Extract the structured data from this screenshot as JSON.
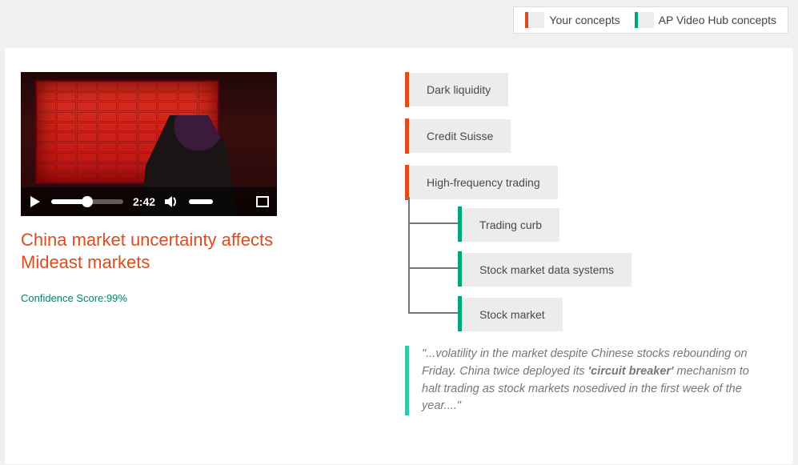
{
  "legend": {
    "yours": "Your concepts",
    "ap": "AP Video Hub concepts"
  },
  "video": {
    "time": "2:42"
  },
  "headline": "China market uncertainty affects Mideast markets",
  "confidence_label": "Confidence Score:",
  "confidence_value": "99%",
  "concepts": {
    "yours": [
      "Dark liquidity",
      "Credit Suisse",
      "High-frequency trading"
    ],
    "ap": [
      "Trading curb",
      "Stock market data systems",
      "Stock market"
    ]
  },
  "quote": {
    "pre": "\"...volatility in the market despite Chinese stocks rebounding on Friday. China twice deployed its ",
    "bold": "'circuit breaker'",
    "post": " mechanism to halt trading as stock markets nosedived in the first week of the year....\""
  }
}
